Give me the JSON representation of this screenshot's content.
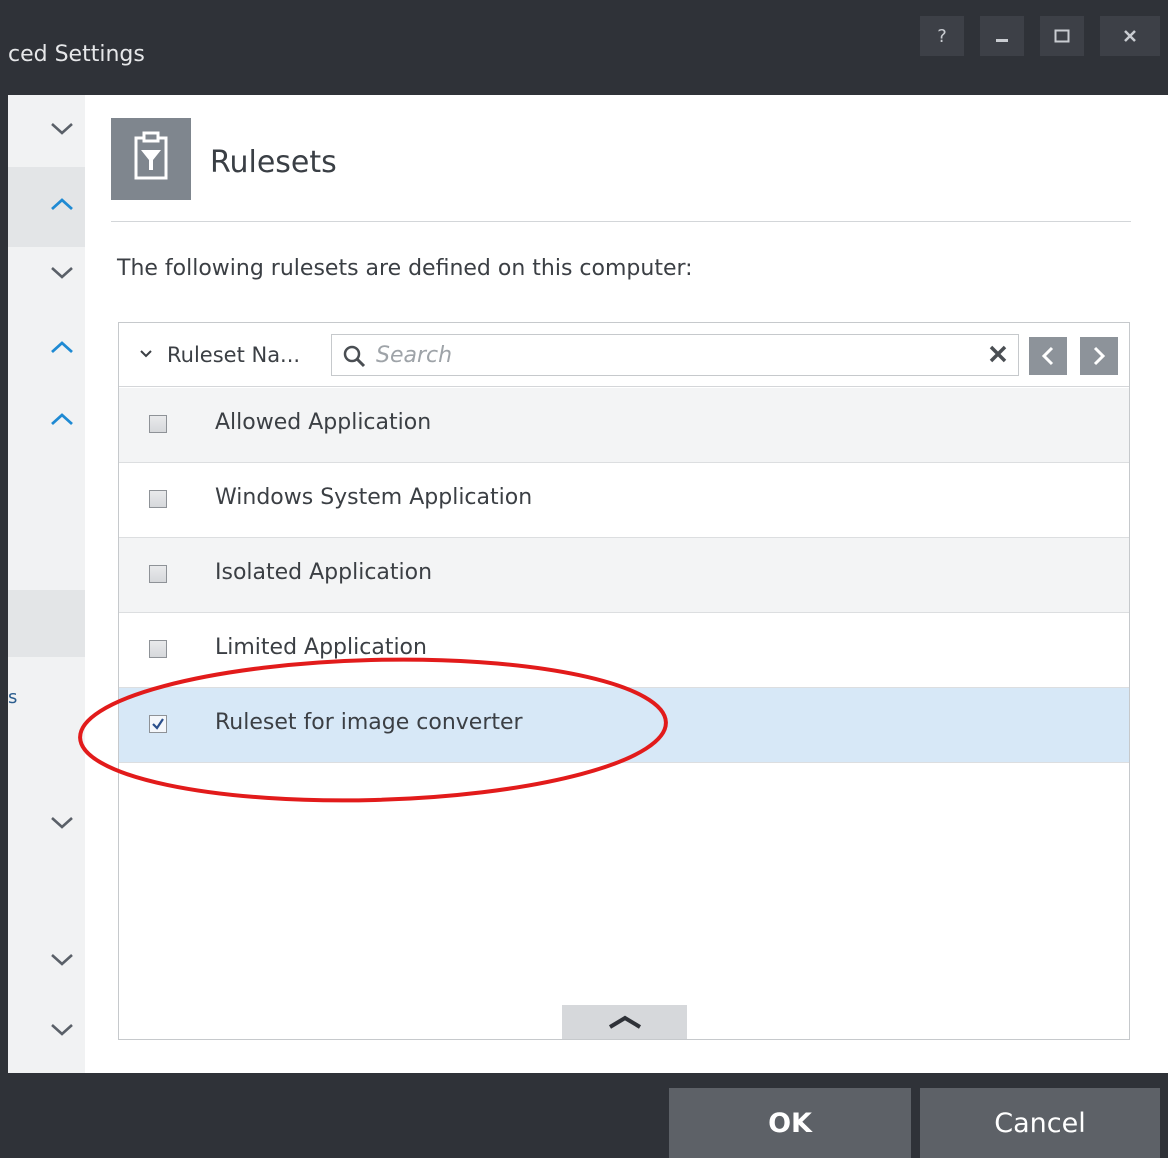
{
  "window": {
    "title": "ced Settings",
    "help_label": "?",
    "minimize_label": "_",
    "maximize_label": "☐",
    "close_label": "✕"
  },
  "sidebar": {
    "fragment_text": "s",
    "chevrons": [
      "down",
      "up",
      "down",
      "up",
      "up",
      "down",
      "down",
      "down"
    ]
  },
  "header": {
    "icon": "ruleset-filter-icon",
    "title": "Rulesets"
  },
  "description": "The following rulesets are defined on this computer:",
  "table": {
    "column_header": "Ruleset Na...",
    "search": {
      "placeholder": "Search",
      "value": ""
    },
    "rows": [
      {
        "label": "Allowed Application",
        "checked": false
      },
      {
        "label": "Windows System Application",
        "checked": false
      },
      {
        "label": "Isolated Application",
        "checked": false
      },
      {
        "label": "Limited Application",
        "checked": false
      },
      {
        "label": "Ruleset for image converter",
        "checked": true
      }
    ]
  },
  "annotation": {
    "shape": "red-oval",
    "color": "#e21b1b"
  },
  "buttons": {
    "ok": "OK",
    "cancel": "Cancel"
  },
  "colors": {
    "titlebar": "#2f3238",
    "accent_blue": "#1f8ad3",
    "selected_row": "#d7e8f7"
  }
}
